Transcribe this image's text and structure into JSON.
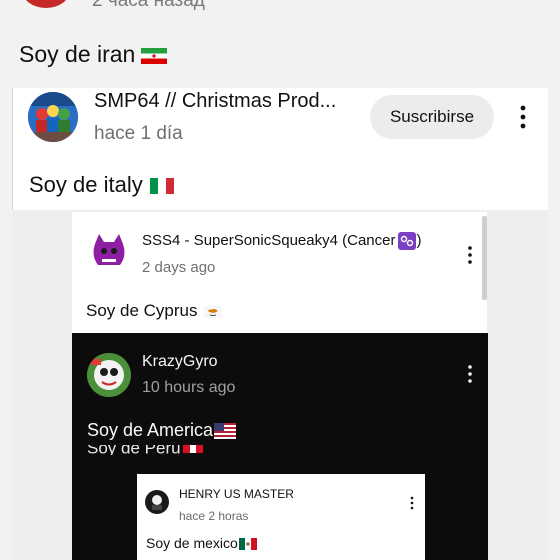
{
  "top": {
    "time": "2 часа назад"
  },
  "comments": [
    {
      "text": "Soy de iran"
    },
    {
      "author": "SMP64 // Christmas Prod...",
      "time": "hace 1 día",
      "subscribe": "Suscribirse",
      "text": "Soy de italy"
    }
  ],
  "screenshot": {
    "c2": {
      "author": "SSS4 - SuperSonicSqueaky4 (Cancer",
      "time": "2 days ago",
      "text": "Soy de Cyprus"
    },
    "c3": {
      "author": "KrazyGyro",
      "time": "10 hours ago",
      "text": "Soy de America",
      "ghost": "Soy de Peru"
    },
    "c4": {
      "author": "HENRY US MASTER",
      "time": "hace 2 horas",
      "text": "Soy de mexico"
    }
  },
  "colors": {
    "background": "#f2f2f2",
    "card": "#ffffff",
    "dark_panel": "#0c0c0c",
    "button": "#ececec"
  },
  "icons": [
    "avatar-icon",
    "more-vert-icon",
    "flag-iran-icon",
    "flag-italy-icon",
    "flag-cyprus-icon",
    "flag-usa-icon",
    "flag-peru-icon",
    "flag-mexico-icon",
    "cancer-zodiac-icon"
  ]
}
